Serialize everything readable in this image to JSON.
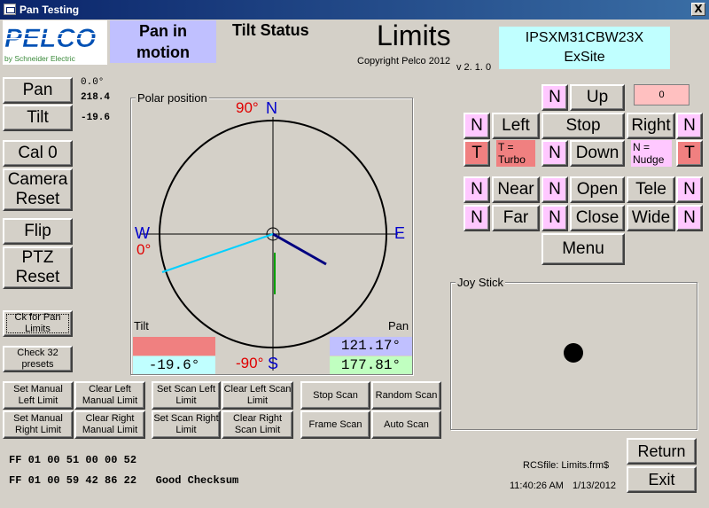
{
  "window": {
    "title": "Pan Testing",
    "close_glyph": "X"
  },
  "logo": {
    "brand": "PELCO",
    "sub": "by Schneider Electric"
  },
  "status": {
    "pan_status": "Pan in\nmotion",
    "tilt_status": "Tilt Status",
    "heading": "Limits",
    "copyright": "Copyright Pelco 2012",
    "version": "v 2. 1. 0",
    "device": "IPSXM31CBW23X\nExSite"
  },
  "left_buttons": {
    "pan": "Pan",
    "tilt": "Tilt",
    "cal0": "Cal 0",
    "camera_reset": "Camera\nReset",
    "flip": "Flip",
    "ptz_reset": "PTZ\nReset",
    "ck_pan_limits": "Ck for Pan\nLimits",
    "check32": "Check 32\npresets"
  },
  "readouts": {
    "pan_a": "0.0°",
    "pan_b": "218.4",
    "tilt": "-19.6"
  },
  "polar": {
    "title": "Polar position",
    "north_deg": "90°",
    "north": "N",
    "west": "W",
    "west_deg": "0°",
    "east": "E",
    "south_deg": "-90°",
    "south": "S",
    "tilt_label": "Tilt",
    "pan_label": "Pan",
    "tilt_value": "-19.6°",
    "pan_value_1": "121.17°",
    "pan_value_2": "177.81°"
  },
  "controls": {
    "n": "N",
    "t": "T",
    "up": "Up",
    "left": "Left",
    "stop": "Stop",
    "right": "Right",
    "down": "Down",
    "turbo_note": "T =\nTurbo",
    "nudge_note": "N =\nNudge",
    "counter": "0",
    "near": "Near",
    "open": "Open",
    "tele": "Tele",
    "far": "Far",
    "close": "Close",
    "wide": "Wide",
    "menu": "Menu"
  },
  "joystick": {
    "title": "Joy Stick"
  },
  "scan_buttons": {
    "set_manual_left": "Set Manual\nLeft Limit",
    "clear_left_manual": "Clear Left\nManual Limit",
    "set_manual_right": "Set Manual\nRight Limit",
    "clear_right_manual": "Clear Right\nManual Limit",
    "set_scan_left": "Set Scan Left\nLimit",
    "clear_left_scan": "Clear Left Scan\nLimit",
    "set_scan_right": "Set Scan Right\nLimit",
    "clear_right_scan": "Clear Right\nScan Limit",
    "stop_scan": "Stop Scan",
    "random_scan": "Random Scan",
    "frame_scan": "Frame Scan",
    "auto_scan": "Auto Scan"
  },
  "footer": {
    "cmd1": "FF 01 00 51 00 00 52",
    "cmd2": "FF 01 00 59 42 86 22   Good Checksum",
    "rcsfile": "RCSfile: Limits.frm$",
    "time": "11:40:26 AM",
    "date": "1/13/2012",
    "return": "Return",
    "exit": "Exit"
  },
  "colors": {
    "pan_status_bg": "#c0c0ff",
    "device_bg": "#c0ffff",
    "nudge": "#ffc8ff",
    "turbo": "#f08080",
    "tilt_box": "#f08080",
    "tilt_value_bg": "#c0ffff",
    "pan_value_1_bg": "#c0c0ff",
    "pan_value_2_bg": "#c0ffc0",
    "north_deg": "#e00000",
    "compass": "#0000cc",
    "pan_line": "#000080",
    "tilt_line": "#00d0ff",
    "green_line": "#00a000"
  },
  "icons": {
    "window_icon": "app-window-icon",
    "close": "close-icon"
  }
}
